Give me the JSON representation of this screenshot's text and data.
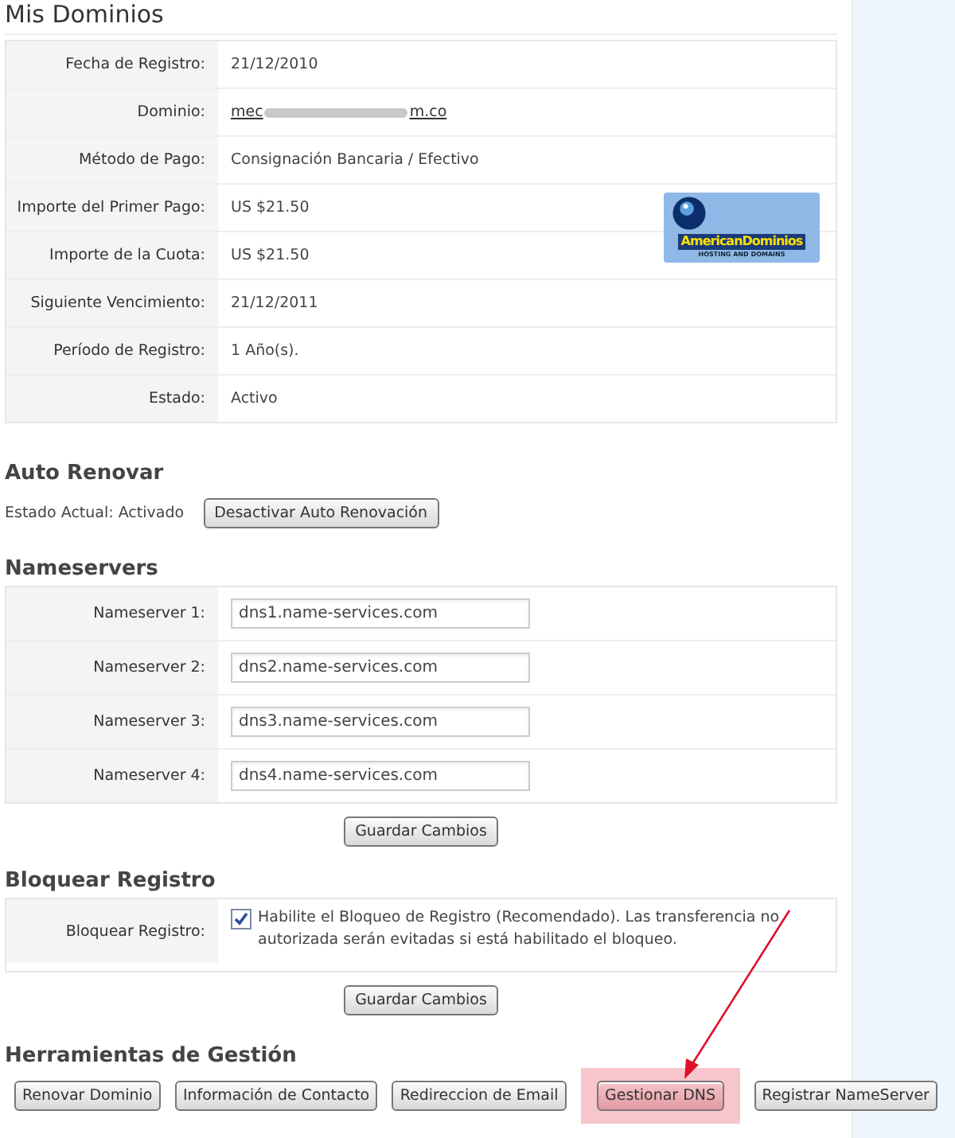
{
  "title": "Mis Dominios",
  "details": [
    {
      "label": "Fecha de Registro:",
      "value": "21/12/2010",
      "kind": "text"
    },
    {
      "label": "Dominio:",
      "kind": "link",
      "value": "mec",
      "value_end": "m.co"
    },
    {
      "label": "Método de Pago:",
      "value": "Consignación Bancaria / Efectivo",
      "kind": "text"
    },
    {
      "label": "Importe del Primer Pago:",
      "value": "US $21.50",
      "kind": "text"
    },
    {
      "label": "Importe de la Cuota:",
      "value": "US $21.50",
      "kind": "text"
    },
    {
      "label": "Siguiente Vencimiento:",
      "value": "21/12/2011",
      "kind": "text"
    },
    {
      "label": "Período de Registro:",
      "value": "1 Año(s).",
      "kind": "text"
    },
    {
      "label": "Estado:",
      "value": "Activo",
      "kind": "text"
    }
  ],
  "logo": {
    "name": "AmericanDominios",
    "tagline": "HOSTING AND DOMAINS"
  },
  "auto_renew": {
    "heading": "Auto Renovar",
    "status": "Estado Actual: Activado",
    "button": "Desactivar Auto Renovación"
  },
  "nameservers": {
    "heading": "Nameservers",
    "rows": [
      {
        "label": "Nameserver 1:",
        "value": "dns1.name-services.com"
      },
      {
        "label": "Nameserver 2:",
        "value": "dns2.name-services.com"
      },
      {
        "label": "Nameserver 3:",
        "value": "dns3.name-services.com"
      },
      {
        "label": "Nameserver 4:",
        "value": "dns4.name-services.com"
      }
    ],
    "button": "Guardar Cambios"
  },
  "lock": {
    "heading": "Bloquear Registro",
    "label": "Bloquear Registro:",
    "checked": true,
    "text": "Habilite el Bloqueo de Registro (Recomendado). Las transferencia no autorizada serán evitadas si está habilitado el bloqueo.",
    "button": "Guardar Cambios"
  },
  "tools": {
    "heading": "Herramientas de Gestión",
    "buttons": [
      {
        "label": "Renovar Dominio",
        "highlighted": false
      },
      {
        "label": "Información de Contacto",
        "highlighted": false
      },
      {
        "label": "Redireccion de Email",
        "highlighted": false
      },
      {
        "label": "Gestionar DNS",
        "highlighted": true
      },
      {
        "label": "Registrar NameServer",
        "highlighted": false
      }
    ]
  }
}
